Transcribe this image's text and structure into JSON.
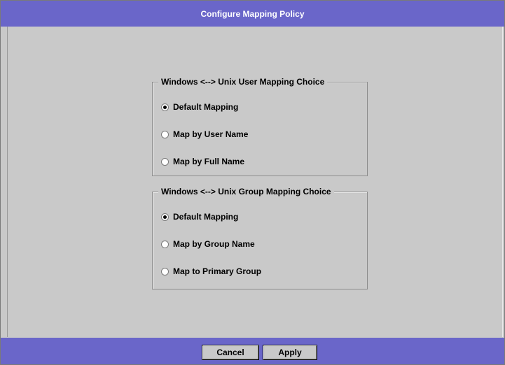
{
  "window": {
    "title": "Configure Mapping Policy"
  },
  "user_mapping": {
    "legend": "Windows <--> Unix User Mapping Choice",
    "options": [
      {
        "label": "Default Mapping",
        "checked": true
      },
      {
        "label": "Map by User Name",
        "checked": false
      },
      {
        "label": "Map by Full Name",
        "checked": false
      }
    ]
  },
  "group_mapping": {
    "legend": "Windows <--> Unix Group Mapping Choice",
    "options": [
      {
        "label": "Default Mapping",
        "checked": true
      },
      {
        "label": "Map by Group Name",
        "checked": false
      },
      {
        "label": "Map to Primary Group",
        "checked": false
      }
    ]
  },
  "buttons": {
    "cancel": "Cancel",
    "apply": "Apply"
  },
  "colors": {
    "bar": "#6a66c9",
    "panel": "#c9c9c9"
  }
}
